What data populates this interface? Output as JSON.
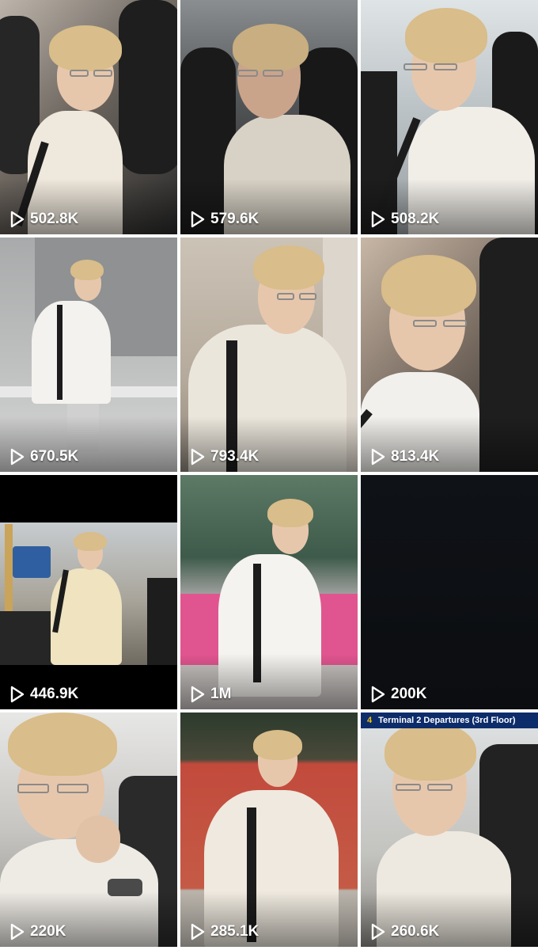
{
  "colors": {
    "background": "#ffffff",
    "count_text": "#ffffff",
    "hair": "#d9bd8a",
    "shirt": "#eeeae2"
  },
  "icons": {
    "play": "play-outline-triangle"
  },
  "videos": [
    {
      "views": "502.8K",
      "scene": "crowd"
    },
    {
      "views": "579.6K",
      "scene": "crowd-dark"
    },
    {
      "views": "508.2K",
      "scene": "terminal"
    },
    {
      "views": "670.5K",
      "scene": "walkway"
    },
    {
      "views": "793.4K",
      "scene": "close-bag"
    },
    {
      "views": "813.4K",
      "scene": "close-crowd"
    },
    {
      "views": "446.9K",
      "scene": "letterbox-outdoor"
    },
    {
      "views": "1M",
      "scene": "pink-bus"
    },
    {
      "views": "200K",
      "scene": "black"
    },
    {
      "views": "220K",
      "scene": "airport-hall"
    },
    {
      "views": "285.1K",
      "scene": "red-wall"
    },
    {
      "views": "260.6K",
      "scene": "terminal-sign"
    }
  ],
  "signage": {
    "gate_digits": "4",
    "text": "Terminal 2 Departures (3rd Floor)"
  }
}
